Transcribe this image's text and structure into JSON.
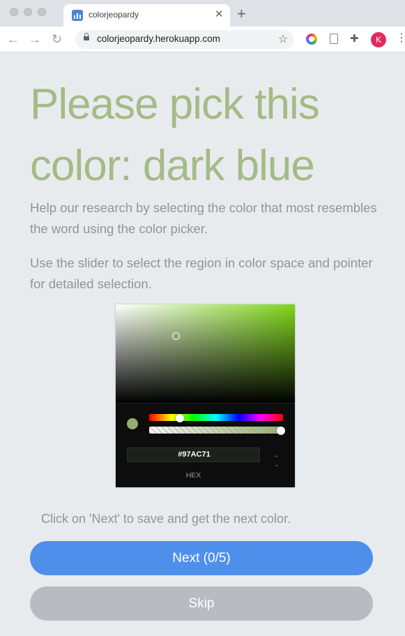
{
  "browser": {
    "tab_title": "colorjeopardy",
    "url": "colorjeopardy.herokuapp.com",
    "profile_initial": "K",
    "icons": [
      "favicon-chart-icon",
      "close-icon",
      "new-tab-icon",
      "back-icon",
      "forward-icon",
      "reload-icon",
      "lock-icon",
      "star-icon",
      "color-extension-icon",
      "document-extension-icon",
      "puzzle-icon",
      "menu-icon"
    ]
  },
  "page": {
    "heading": "Please pick this color: dark blue",
    "paragraph1": "Help our research by selecting the color that most resembles the word using the color picker.",
    "paragraph2": "Use the slider to select the region in color space and pointer for detailed selection.",
    "hint": "Click on 'Next' to save and get the next color."
  },
  "picker": {
    "hex_value": "#97AC71",
    "hex_label": "HEX",
    "selected_color": "#97ac71",
    "hue_color": "#7fd61b",
    "alpha_fraction": 1.0
  },
  "buttons": {
    "next_label": "Next (0/5)",
    "skip_label": "Skip"
  },
  "colors": {
    "heading": "#a4bb86",
    "body_text": "#8f959b",
    "next_button": "#4f8fec",
    "skip_button": "#b8bcc2",
    "background": "#e8ebee"
  }
}
